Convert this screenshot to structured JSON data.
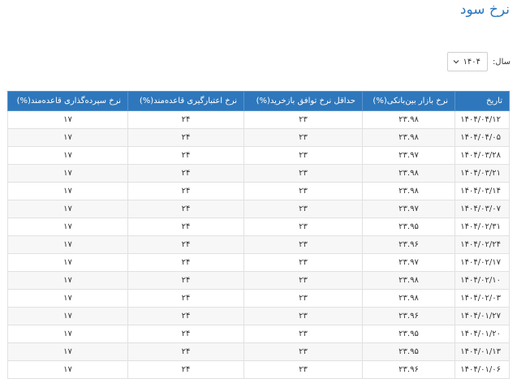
{
  "page": {
    "title": "نرخ سود"
  },
  "filter": {
    "year_label": "سال:",
    "year_value": "۱۴۰۴"
  },
  "table": {
    "headers": {
      "date": "تاریخ",
      "interbank": "نرخ بازار بین‌بانکی(%)",
      "repo_min": "حداقل نرخ توافق بازخرید(%)",
      "credit": "نرخ اعتبارگیری قاعده‌مند(%)",
      "deposit": "نرخ سپرده‌گذاری قاعده‌مند(%)"
    },
    "rows": [
      {
        "date": "۱۴۰۴/۰۴/۱۲",
        "interbank": "۲۳.۹۸",
        "repo_min": "۲۳",
        "credit": "۲۴",
        "deposit": "۱۷"
      },
      {
        "date": "۱۴۰۴/۰۴/۰۵",
        "interbank": "۲۳.۹۸",
        "repo_min": "۲۳",
        "credit": "۲۴",
        "deposit": "۱۷"
      },
      {
        "date": "۱۴۰۴/۰۳/۲۸",
        "interbank": "۲۳.۹۷",
        "repo_min": "۲۳",
        "credit": "۲۴",
        "deposit": "۱۷"
      },
      {
        "date": "۱۴۰۴/۰۳/۲۱",
        "interbank": "۲۳.۹۸",
        "repo_min": "۲۳",
        "credit": "۲۴",
        "deposit": "۱۷"
      },
      {
        "date": "۱۴۰۴/۰۳/۱۴",
        "interbank": "۲۳.۹۸",
        "repo_min": "۲۳",
        "credit": "۲۴",
        "deposit": "۱۷"
      },
      {
        "date": "۱۴۰۴/۰۳/۰۷",
        "interbank": "۲۳.۹۷",
        "repo_min": "۲۳",
        "credit": "۲۴",
        "deposit": "۱۷"
      },
      {
        "date": "۱۴۰۴/۰۲/۳۱",
        "interbank": "۲۳.۹۵",
        "repo_min": "۲۳",
        "credit": "۲۴",
        "deposit": "۱۷"
      },
      {
        "date": "۱۴۰۴/۰۲/۲۴",
        "interbank": "۲۳.۹۶",
        "repo_min": "۲۳",
        "credit": "۲۴",
        "deposit": "۱۷"
      },
      {
        "date": "۱۴۰۴/۰۲/۱۷",
        "interbank": "۲۳.۹۷",
        "repo_min": "۲۳",
        "credit": "۲۴",
        "deposit": "۱۷"
      },
      {
        "date": "۱۴۰۴/۰۲/۱۰",
        "interbank": "۲۳.۹۸",
        "repo_min": "۲۳",
        "credit": "۲۴",
        "deposit": "۱۷"
      },
      {
        "date": "۱۴۰۴/۰۲/۰۳",
        "interbank": "۲۳.۹۸",
        "repo_min": "۲۳",
        "credit": "۲۴",
        "deposit": "۱۷"
      },
      {
        "date": "۱۴۰۴/۰۱/۲۷",
        "interbank": "۲۳.۹۶",
        "repo_min": "۲۳",
        "credit": "۲۴",
        "deposit": "۱۷"
      },
      {
        "date": "۱۴۰۴/۰۱/۲۰",
        "interbank": "۲۳.۹۵",
        "repo_min": "۲۳",
        "credit": "۲۴",
        "deposit": "۱۷"
      },
      {
        "date": "۱۴۰۴/۰۱/۱۳",
        "interbank": "۲۳.۹۵",
        "repo_min": "۲۳",
        "credit": "۲۴",
        "deposit": "۱۷"
      },
      {
        "date": "۱۴۰۴/۰۱/۰۶",
        "interbank": "۲۳.۹۶",
        "repo_min": "۲۳",
        "credit": "۲۴",
        "deposit": "۱۷"
      }
    ]
  },
  "icons": {
    "year_dropdown": "chevron-down-icon"
  },
  "colors": {
    "accent": "#2e77bc",
    "header_text": "#ffffff",
    "row_stripe": "#f7f7f7"
  }
}
